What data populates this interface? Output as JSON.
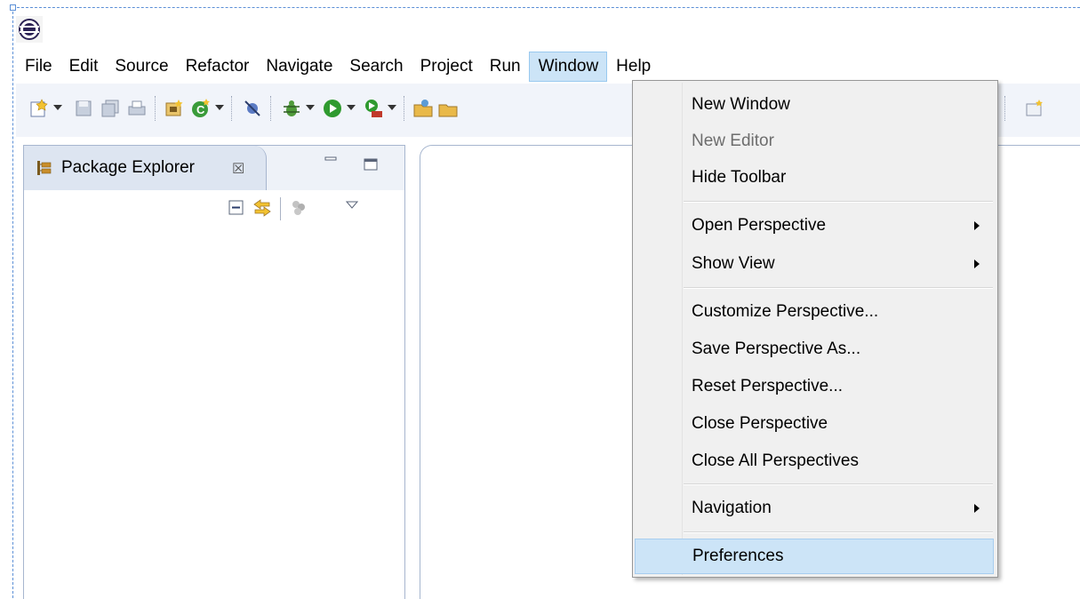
{
  "menubar": {
    "items": [
      "File",
      "Edit",
      "Source",
      "Refactor",
      "Navigate",
      "Search",
      "Project",
      "Run",
      "Window",
      "Help"
    ],
    "active": "Window"
  },
  "package_explorer": {
    "title": "Package Explorer",
    "close_glyph": "☒"
  },
  "window_menu": {
    "items": [
      {
        "label": "New Window",
        "enabled": true,
        "submenu": false
      },
      {
        "label": "New Editor",
        "enabled": false,
        "submenu": false
      },
      {
        "label": "Hide Toolbar",
        "enabled": true,
        "submenu": false
      },
      {
        "label": "Open Perspective",
        "enabled": true,
        "submenu": true
      },
      {
        "label": "Show View",
        "enabled": true,
        "submenu": true
      },
      {
        "label": "Customize Perspective...",
        "enabled": true,
        "submenu": false
      },
      {
        "label": "Save Perspective As...",
        "enabled": true,
        "submenu": false
      },
      {
        "label": "Reset Perspective...",
        "enabled": true,
        "submenu": false
      },
      {
        "label": "Close Perspective",
        "enabled": true,
        "submenu": false
      },
      {
        "label": "Close All Perspectives",
        "enabled": true,
        "submenu": false
      },
      {
        "label": "Navigation",
        "enabled": true,
        "submenu": true
      },
      {
        "label": "Preferences",
        "enabled": true,
        "submenu": false,
        "highlighted": true
      }
    ]
  },
  "colors": {
    "menu_highlight": "#cce4f7",
    "toolbar_bg": "#f1f4fa",
    "selection_dash": "#5b8fd6"
  },
  "icons": {
    "app": "eclipse-icon",
    "toolbar": [
      "new-wizard-icon",
      "save-icon",
      "save-all-icon",
      "print-icon",
      "new-java-project-icon",
      "new-class-icon",
      "skip-breakpoints-icon",
      "debug-icon",
      "run-icon",
      "external-tools-icon",
      "open-type-icon",
      "open-task-icon"
    ]
  }
}
